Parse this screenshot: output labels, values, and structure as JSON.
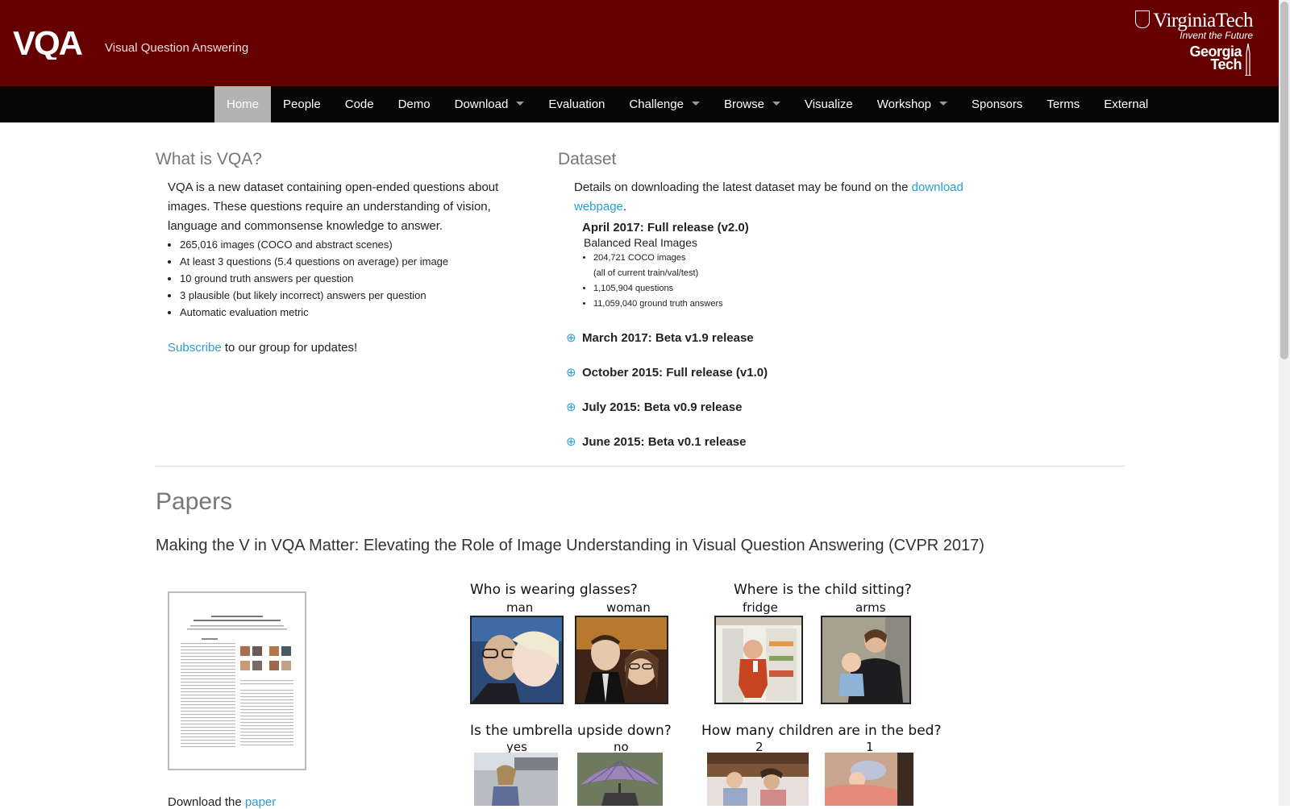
{
  "header": {
    "logo": "VQA",
    "logo_subtitle": "Visual Question Answering",
    "vt_name": "VirginiaTech",
    "vt_tagline": "Invent the Future",
    "gt_line1": "Georgia",
    "gt_line2": "Tech"
  },
  "nav": [
    {
      "label": "Home",
      "active": true
    },
    {
      "label": "People"
    },
    {
      "label": "Code"
    },
    {
      "label": "Demo"
    },
    {
      "label": "Download",
      "dropdown": true
    },
    {
      "label": "Evaluation"
    },
    {
      "label": "Challenge",
      "dropdown": true
    },
    {
      "label": "Browse",
      "dropdown": true
    },
    {
      "label": "Visualize"
    },
    {
      "label": "Workshop",
      "dropdown": true
    },
    {
      "label": "Sponsors"
    },
    {
      "label": "Terms"
    },
    {
      "label": "External"
    }
  ],
  "what": {
    "title": "What is VQA?",
    "intro": "VQA is a new dataset containing open-ended questions about images. These questions require an understanding of vision, language and commonsense knowledge to answer.",
    "bullets": [
      "265,016 images (COCO and abstract scenes)",
      "At least 3 questions (5.4 questions on average) per image",
      "10 ground truth answers per question",
      "3 plausible (but likely incorrect) answers per question",
      "Automatic evaluation metric"
    ],
    "subscribe_link": "Subscribe",
    "subscribe_rest": " to our group for updates!"
  },
  "dataset": {
    "title": "Dataset",
    "intro_text": "Details on downloading the latest dataset may be found on the ",
    "intro_link": "download webpage",
    "intro_end": ".",
    "current": {
      "title": "April 2017: Full release (v2.0)",
      "subtitle": "Balanced Real Images",
      "bullet1": "204,721 COCO images",
      "bullet1_note": "(all of current train/val/test)",
      "bullet2": "1,105,904 questions",
      "bullet3": "11,059,040 ground truth answers"
    },
    "toggle_symbol": "⊕",
    "older": [
      "March 2017: Beta v1.9 release",
      "October 2015: Full release (v1.0)",
      "July 2015: Beta v0.9 release",
      "June 2015: Beta v0.1 release"
    ]
  },
  "papers": {
    "heading": "Papers",
    "paper_title": "Making the V in VQA Matter: Elevating the Role of Image Understanding in Visual Question Answering (CVPR 2017)",
    "download_text": "Download the ",
    "download_link": "paper"
  },
  "examples": [
    {
      "question": "Who is wearing glasses?",
      "answers": [
        "man",
        "woman"
      ]
    },
    {
      "question": "Where is the child sitting?",
      "answers": [
        "fridge",
        "arms"
      ]
    },
    {
      "question": "Is the umbrella upside down?",
      "answers": [
        "yes",
        "no"
      ]
    },
    {
      "question": "How many children are in the bed?",
      "answers": [
        "2",
        "1"
      ]
    }
  ]
}
